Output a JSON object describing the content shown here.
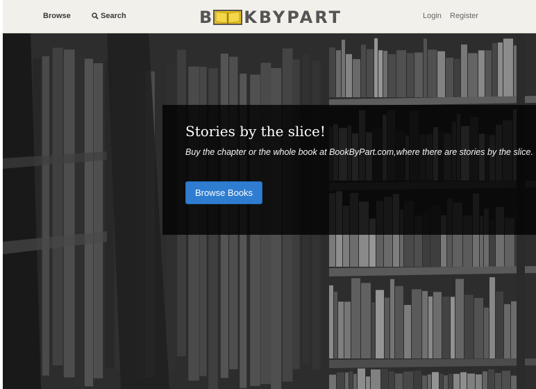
{
  "nav": {
    "browse_label": "Browse",
    "search_label": "Search",
    "search_icon": "magnifier-icon",
    "login_label": "Login",
    "register_label": "Register"
  },
  "logo": {
    "text": "BOOKBYPART",
    "letter_b": "B",
    "letters_rest": "KBYPART",
    "icon": "open-book-icon",
    "accent_color": "#e8c21a"
  },
  "hero": {
    "title": "Stories by the slice!",
    "subtitle": "Buy the chapter or the whole book at BookByPart.com,where there are stories by the slice.",
    "cta_label": "Browse Books",
    "cta_color": "#2f7dd1"
  }
}
